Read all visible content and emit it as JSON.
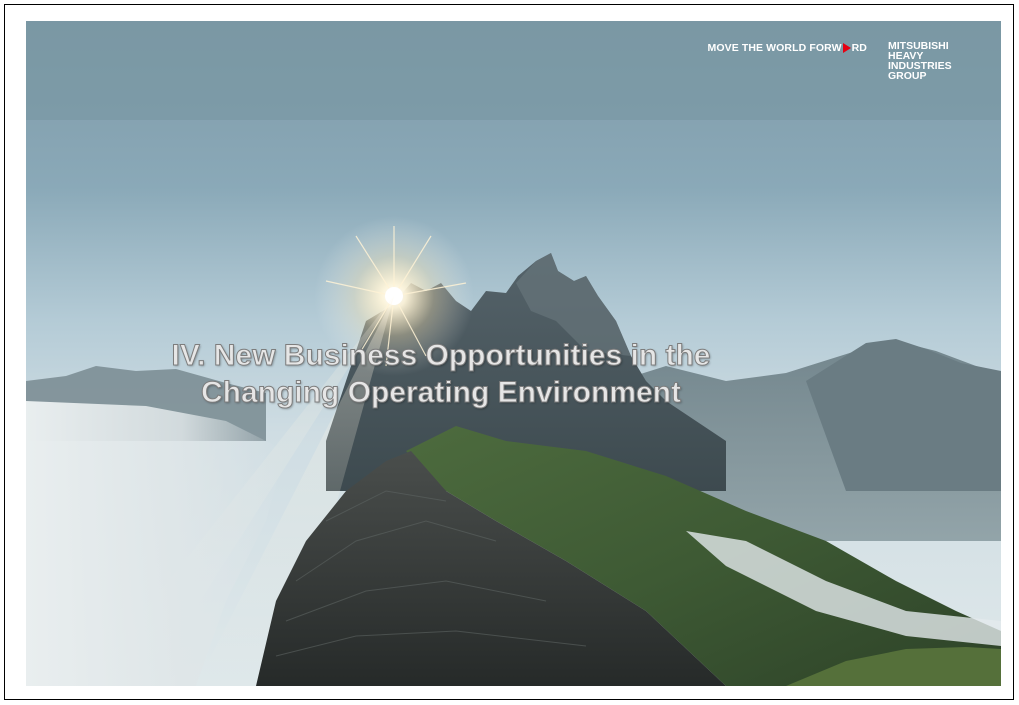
{
  "slide": {
    "tagline": {
      "part1": "MOVE THE WORLD FORW",
      "part2": "RD"
    },
    "brand_lines": [
      "MITSUBISHI",
      "HEAVY",
      "INDUSTRIES",
      "GROUP"
    ],
    "title_lines": [
      "IV. New Business Opportunities in the",
      "Changing Operating Environment"
    ],
    "background_image": "mountain-sunrise-photo"
  },
  "colors": {
    "accent_red": "#e60012",
    "title_fill": "#e6e6e6",
    "title_outline": "#7d7d7d",
    "sky_top": "#7f9aa8",
    "sky_bottom": "#c9dbe3"
  }
}
